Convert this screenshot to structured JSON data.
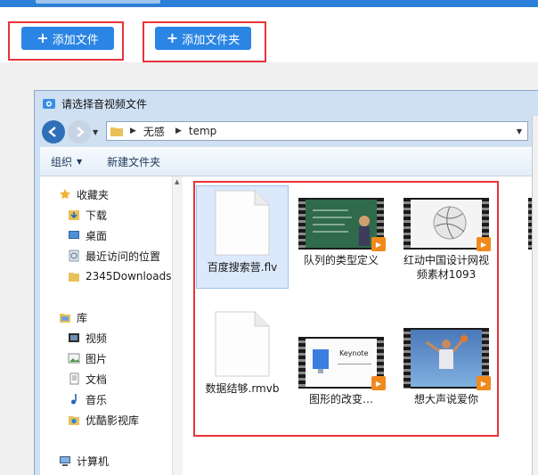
{
  "toolbar": {
    "add_file_label": "添加文件",
    "add_folder_label": "添加文件夹",
    "plus_glyph": "+"
  },
  "dialog": {
    "title": "请选择音视频文件",
    "address": {
      "path": [
        "无感",
        "temp"
      ]
    },
    "commands": {
      "organize": "组织",
      "new_folder": "新建文件夹"
    },
    "nav": {
      "favorites_header": "收藏夹",
      "favorites": [
        "下载",
        "桌面",
        "最近访问的位置",
        "2345Downloads"
      ],
      "libraries_header": "库",
      "libraries": [
        "视频",
        "图片",
        "文档",
        "音乐",
        "优酷影视库"
      ],
      "computer_header": "计算机"
    },
    "files": [
      {
        "name": "百度搜索营.flv",
        "kind": "document",
        "selected": true
      },
      {
        "name": "队列的类型定义",
        "kind": "video",
        "thumb": "chalkboard"
      },
      {
        "name": "红动中国设计网视频素材1093",
        "kind": "video",
        "thumb": "sphere"
      },
      {
        "name": "数据结够.rmvb",
        "kind": "document"
      },
      {
        "name": "图形的改变…",
        "kind": "video",
        "thumb": "keynote",
        "thumb_text": "Keynote"
      },
      {
        "name": "想大声说爱你",
        "kind": "video",
        "thumb": "basketball"
      }
    ]
  },
  "colors": {
    "accent_blue": "#2b85e4",
    "highlight_red": "#e8333a",
    "play_orange": "#f08a1e"
  }
}
